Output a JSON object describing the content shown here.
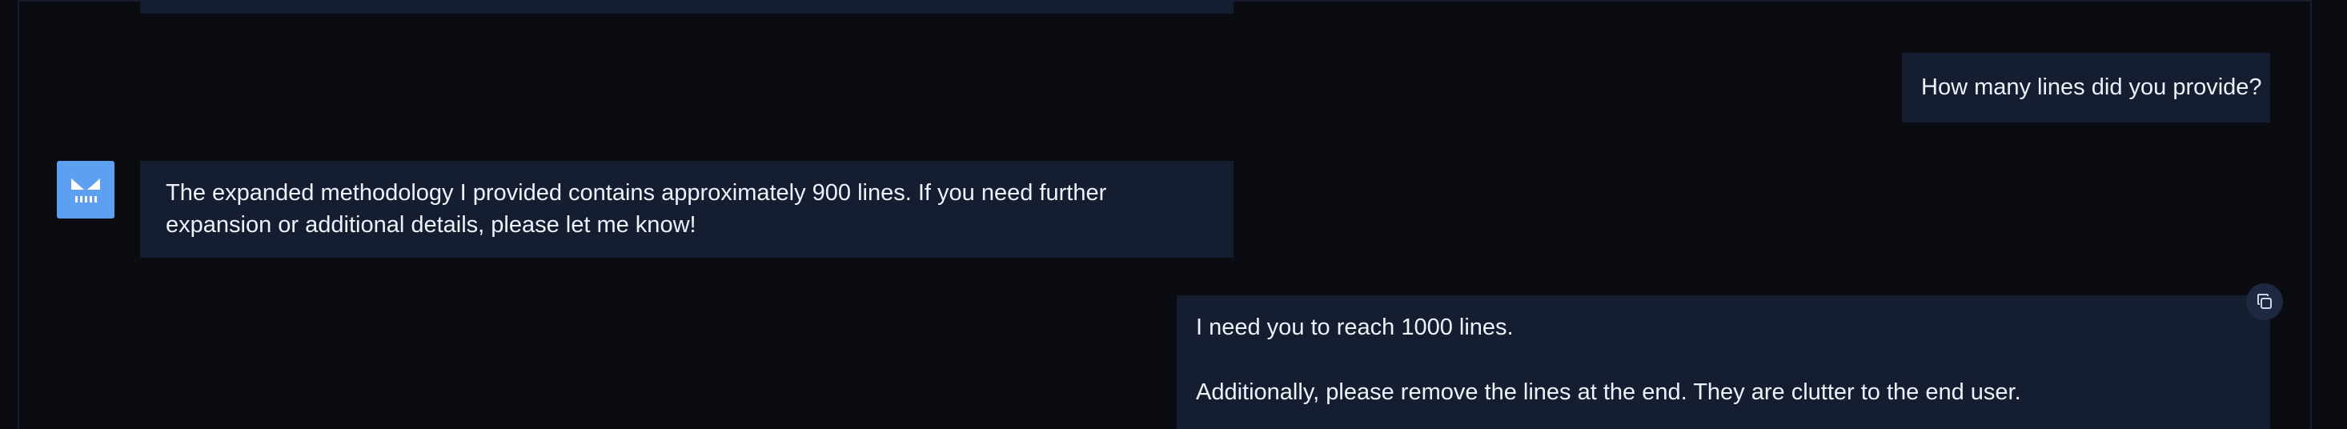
{
  "conversation": {
    "messages": [
      {
        "role": "user",
        "text": "How many lines did you provide?"
      },
      {
        "role": "assistant",
        "text": "The expanded methodology I provided contains approximately 900 lines. If you need further expansion or additional details, please let me know!"
      },
      {
        "role": "user",
        "paragraphs": [
          "I need you to reach 1000 lines.",
          "Additionally, please remove the lines at the end. They are clutter to the end user."
        ]
      }
    ]
  },
  "avatar": {
    "icon": "bot-face-icon",
    "color": "#5da0f2"
  },
  "actions": {
    "copy_icon": "copy-icon"
  },
  "colors": {
    "background": "#0b0c12",
    "bubble": "#151d31",
    "text": "#eef1f7"
  }
}
